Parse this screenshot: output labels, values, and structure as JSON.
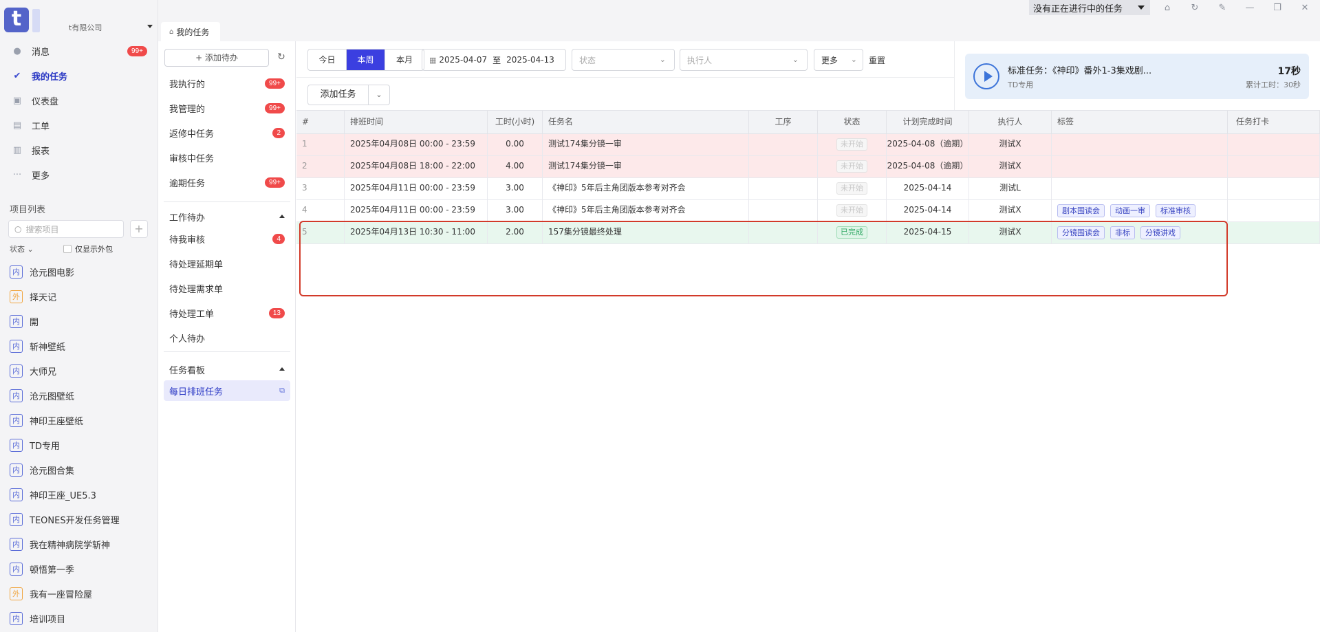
{
  "app": {
    "logo_letter": "t",
    "company": "t有限公司"
  },
  "nav": {
    "items": [
      {
        "label": "消息",
        "icon": "message-icon",
        "badge": "99+"
      },
      {
        "label": "我的任务",
        "icon": "task-check-icon",
        "badge": ""
      },
      {
        "label": "仪表盘",
        "icon": "dashboard-icon",
        "badge": ""
      },
      {
        "label": "工单",
        "icon": "ticket-icon",
        "badge": ""
      },
      {
        "label": "报表",
        "icon": "report-icon",
        "badge": ""
      },
      {
        "label": "更多",
        "icon": "more-dots-icon",
        "badge": ""
      }
    ]
  },
  "projects": {
    "title": "项目列表",
    "search_placeholder": "搜索项目",
    "status_label": "状态",
    "outsource_label": "仅显示外包",
    "items": [
      {
        "tag": "内",
        "name": "沧元图电影"
      },
      {
        "tag": "外",
        "name": "择天记"
      },
      {
        "tag": "内",
        "name": "開"
      },
      {
        "tag": "内",
        "name": "斩神壁纸"
      },
      {
        "tag": "内",
        "name": "大师兄"
      },
      {
        "tag": "内",
        "name": "沧元图壁纸"
      },
      {
        "tag": "内",
        "name": "神印王座壁纸"
      },
      {
        "tag": "内",
        "name": "TD专用"
      },
      {
        "tag": "内",
        "name": "沧元图合集"
      },
      {
        "tag": "内",
        "name": "神印王座_UE5.3"
      },
      {
        "tag": "内",
        "name": "TEONES开发任务管理"
      },
      {
        "tag": "内",
        "name": "我在精神病院学斩神"
      },
      {
        "tag": "内",
        "name": "顿悟第一季"
      },
      {
        "tag": "外",
        "name": "我有一座冒险屋"
      },
      {
        "tag": "内",
        "name": "培训项目"
      }
    ]
  },
  "tabbar": {
    "tab_label": "我的任务",
    "running_task": "没有正在进行中的任务"
  },
  "middle": {
    "add_todo": "+ 添加待办",
    "items_top": [
      {
        "label": "我执行的",
        "badge": "99+"
      },
      {
        "label": "我管理的",
        "badge": "99+"
      },
      {
        "label": "返修中任务",
        "badge": "2"
      },
      {
        "label": "审核中任务",
        "badge": ""
      },
      {
        "label": "逾期任务",
        "badge": "99+"
      }
    ],
    "section_work": "工作待办",
    "items_work": [
      {
        "label": "待我审核",
        "badge": "4"
      },
      {
        "label": "待处理延期单",
        "badge": ""
      },
      {
        "label": "待处理需求单",
        "badge": ""
      },
      {
        "label": "待处理工单",
        "badge": "13"
      },
      {
        "label": "个人待办",
        "badge": ""
      }
    ],
    "section_board": "任务看板",
    "board_item": "每日排班任务"
  },
  "filters": {
    "periods": [
      "今日",
      "本周",
      "本月"
    ],
    "active_period": "本周",
    "date_start": "2025-04-07",
    "date_sep": "至",
    "date_end": "2025-04-13",
    "status_placeholder": "状态",
    "assignee_placeholder": "执行人",
    "more": "更多",
    "reset": "重置",
    "add_task": "添加任务"
  },
  "timer": {
    "title": "标准任务：《神印》番外1-3集戏剧...",
    "subtitle": "TD专用",
    "elapsed": "17秒",
    "total": "累计工时：30秒"
  },
  "table": {
    "columns": [
      "#",
      "排班时间",
      "工时(小时)",
      "任务名",
      "工序",
      "状态",
      "计划完成时间",
      "执行人",
      "标签",
      "任务打卡"
    ],
    "rows": [
      {
        "idx": "1",
        "time": "2025年04月08日 00:00 - 23:59",
        "hours": "0.00",
        "name": "测试174集分镜一审",
        "process": "",
        "status": "未开始",
        "status_kind": "notstart",
        "due": "2025-04-08（逾期）",
        "assignee": "测试X",
        "tags": [],
        "tone": "red"
      },
      {
        "idx": "2",
        "time": "2025年04月08日 18:00 - 22:00",
        "hours": "4.00",
        "name": "测试174集分镜一审",
        "process": "",
        "status": "未开始",
        "status_kind": "notstart",
        "due": "2025-04-08（逾期）",
        "assignee": "测试X",
        "tags": [],
        "tone": "red"
      },
      {
        "idx": "3",
        "time": "2025年04月11日 00:00 - 23:59",
        "hours": "3.00",
        "name": "《神印》5年后主角团版本参考对齐会",
        "process": "",
        "status": "未开始",
        "status_kind": "notstart",
        "due": "2025-04-14",
        "assignee": "测试L",
        "tags": [],
        "tone": ""
      },
      {
        "idx": "4",
        "time": "2025年04月11日 00:00 - 23:59",
        "hours": "3.00",
        "name": "《神印》5年后主角团版本参考对齐会",
        "process": "",
        "status": "未开始",
        "status_kind": "notstart",
        "due": "2025-04-14",
        "assignee": "测试X",
        "tags": [
          "剧本围读会",
          "动画一审",
          "标准审核"
        ],
        "tone": ""
      },
      {
        "idx": "5",
        "time": "2025年04月13日 10:30 - 11:00",
        "hours": "2.00",
        "name": "157集分镜最终处理",
        "process": "",
        "status": "已完成",
        "status_kind": "done",
        "due": "2025-04-15",
        "assignee": "测试X",
        "tags": [
          "分镜围读会",
          "非标",
          "分镜讲戏"
        ],
        "tone": "green"
      }
    ]
  }
}
